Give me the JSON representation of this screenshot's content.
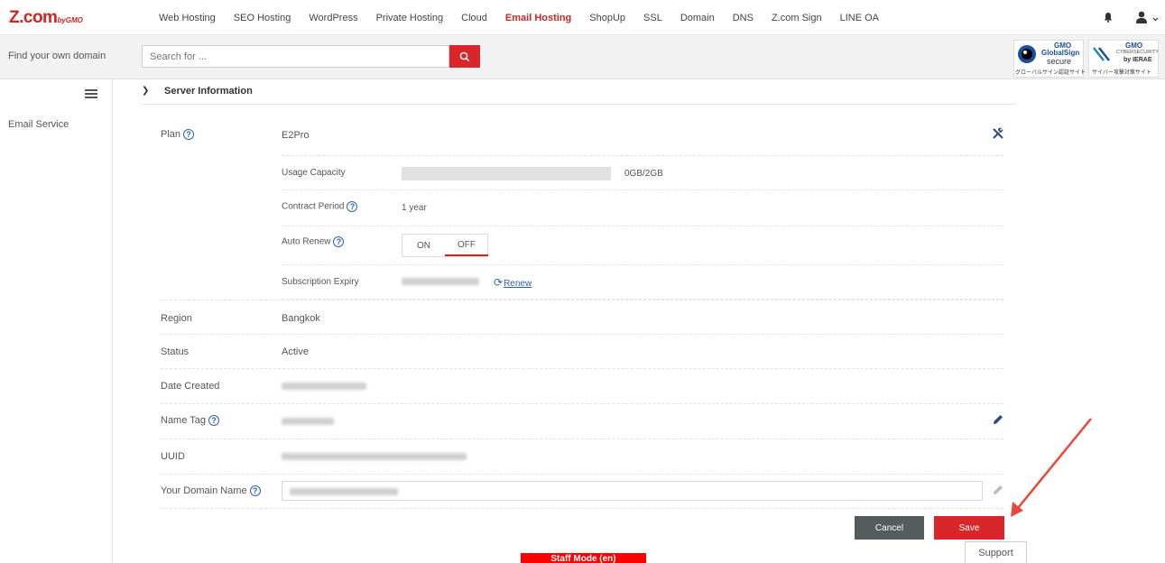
{
  "brand": {
    "logo_main": "Z.com",
    "logo_sub": "by GMO"
  },
  "nav": {
    "items": [
      "Web Hosting",
      "SEO Hosting",
      "WordPress",
      "Private Hosting",
      "Cloud",
      "Email Hosting",
      "ShopUp",
      "SSL",
      "Domain",
      "DNS",
      "Z.com Sign",
      "LINE OA"
    ],
    "active": "Email Hosting"
  },
  "search": {
    "label": "Find your own domain",
    "placeholder": "Search for ..."
  },
  "badges": {
    "globalsign": {
      "line1": "GMO",
      "line2": "GlobalSign",
      "line3": "secure",
      "line4": "グローバルサイン認証サイト"
    },
    "ierae": {
      "line1": "GMO",
      "line2": "CYBERSECURITY",
      "line3": "by IERAE",
      "line4": "サイバー攻撃対策サイト"
    }
  },
  "sidebar": {
    "items": [
      {
        "label": "Email Service"
      }
    ]
  },
  "section": {
    "title": "Server Information"
  },
  "plan": {
    "label": "Plan",
    "value": "E2Pro"
  },
  "usage": {
    "label": "Usage Capacity",
    "value": "0GB/2GB",
    "fraction": 0
  },
  "contract": {
    "label": "Contract Period",
    "value": "1 year"
  },
  "auto_renew": {
    "label": "Auto Renew",
    "on": "ON",
    "off": "OFF",
    "selected": "OFF"
  },
  "expiry": {
    "label": "Subscription Expiry",
    "renew": "Renew"
  },
  "region": {
    "label": "Region",
    "value": "Bangkok"
  },
  "status": {
    "label": "Status",
    "value": "Active"
  },
  "date_created": {
    "label": "Date Created"
  },
  "name_tag": {
    "label": "Name Tag"
  },
  "uuid": {
    "label": "UUID"
  },
  "domain": {
    "label": "Your Domain Name"
  },
  "buttons": {
    "cancel": "Cancel",
    "save": "Save",
    "support": "Support"
  },
  "staff_mode": "Staff Mode (en)",
  "colors": {
    "accent": "#d9262b",
    "link": "#2c62b5",
    "cancel": "#555c5e"
  }
}
